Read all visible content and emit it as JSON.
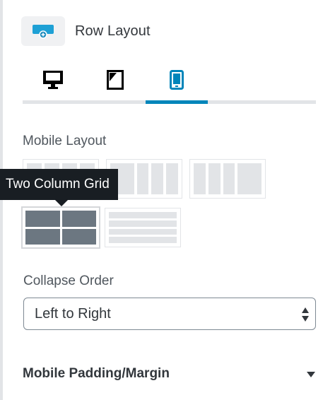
{
  "block": {
    "title": "Row Layout",
    "icon": "row-layout-block-icon"
  },
  "tabs": [
    {
      "name": "desktop",
      "icon": "desktop-icon",
      "active": false
    },
    {
      "name": "tablet",
      "icon": "tablet-icon",
      "active": false
    },
    {
      "name": "mobile",
      "icon": "mobile-icon",
      "active": true
    }
  ],
  "mobile_layout": {
    "label": "Mobile Layout",
    "tooltip": "Two Column Grid",
    "selected": "two-column-grid",
    "options": [
      "equal-columns",
      "left-heavy-columns",
      "right-heavy-columns",
      "two-column-grid",
      "row-stack"
    ]
  },
  "collapse_order": {
    "label": "Collapse Order",
    "value": "Left to Right"
  },
  "padding_panel": {
    "title": "Mobile Padding/Margin",
    "expanded": false
  },
  "colors": {
    "accent": "#0085ba",
    "tooltip_bg": "#191e23",
    "selected_cell": "#6c7781",
    "cell": "#e2e4e7",
    "text": "#32373c"
  }
}
